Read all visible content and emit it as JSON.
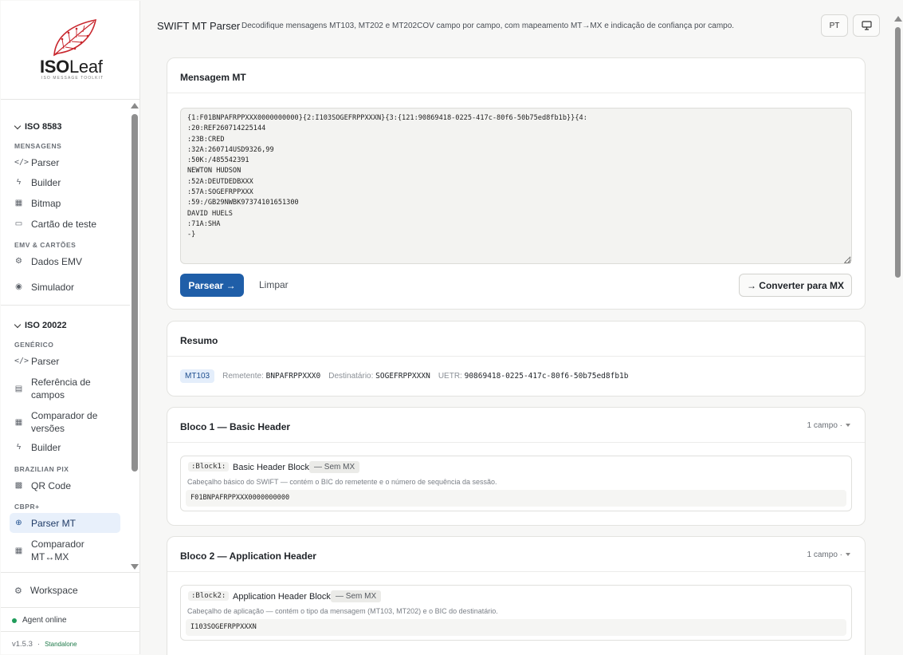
{
  "sidebar": {
    "logo": {
      "brand_bold": "ISO",
      "brand_light": "Leaf",
      "tagline": "ISO MESSAGE TOOLKIT",
      "accent": "#c8262d"
    },
    "groups": [
      {
        "label": "ISO 8583"
      },
      {
        "label": "ISO 20022"
      }
    ],
    "sections": [
      "MENSAGENS",
      "EMV & CARTÕES",
      "GENÉRICO",
      "BRAZILIAN PIX",
      "CBPR+"
    ],
    "items": [
      {
        "label": "Parser",
        "icon": "code-icon"
      },
      {
        "label": "Builder",
        "icon": "bolt-icon"
      },
      {
        "label": "Bitmap",
        "icon": "grid-icon"
      },
      {
        "label": "Cartão de teste",
        "icon": "card-icon"
      },
      {
        "label": "Dados EMV",
        "icon": "chip-icon"
      },
      {
        "label": "Simulador",
        "icon": "broadcast-icon"
      },
      {
        "label": "Parser",
        "icon": "code-icon"
      },
      {
        "label": "Referência de campos",
        "icon": "document-icon"
      },
      {
        "label": "Comparador de versões",
        "icon": "grid-icon"
      },
      {
        "label": "Builder",
        "icon": "bolt-icon"
      },
      {
        "label": "QR Code",
        "icon": "qr-icon"
      },
      {
        "label": "Parser MT",
        "icon": "globe-icon",
        "active": true
      },
      {
        "label": "Comparador MT↔MX",
        "icon": "grid-icon"
      }
    ],
    "workspace": "Workspace",
    "agent_status": "Agent online",
    "version": "v1.5.3",
    "mode": "Standalone",
    "status_color": "#1f9c5a"
  },
  "header": {
    "title": "SWIFT MT Parser",
    "subtitle": "Decodifique mensagens MT103, MT202 e MT202COV campo por campo, com mapeamento MT→MX e indicação de confiança por campo.",
    "lang_button": "PT"
  },
  "message_card": {
    "title": "Mensagem MT",
    "content": "{1:F01BNPAFRPPXXX0000000000}{2:I103SOGEFRPPXXXN}{3:{121:90869418-0225-417c-80f6-50b75ed8fb1b}}{4:\n:20:REF260714225144\n:23B:CRED\n:32A:260714USD9326,99\n:50K:/485542391\nNEWTON HUDSON\n:52A:DEUTDEDBXXX\n:57A:SOGEFRPPXXX\n:59:/GB29NWBK97374101651300\nDAVID HUELS\n:71A:SHA\n-}",
    "parse_button": "Parsear →",
    "clear_button": "Limpar",
    "convert_button": "→ Converter para MX",
    "accent": "#1f5ea8"
  },
  "summary": {
    "title": "Resumo",
    "type": "MT103",
    "sender_label": "Remetente:",
    "sender": "BNPAFRPPXXX0",
    "receiver_label": "Destinatário:",
    "receiver": "SOGEFRPPXXXN",
    "uetr_label": "UETR:",
    "uetr": "90869418-0225-417c-80f6-50b75ed8fb1b"
  },
  "blocks": [
    {
      "title": "Bloco 1 — Basic Header",
      "count": "1 campo ·",
      "tag": ":Block1:",
      "name": "Basic Header Block",
      "mx": "— Sem MX",
      "desc": "Cabeçalho básico do SWIFT — contém o BIC do remetente e o número de sequência da sessão.",
      "value": "F01BNPAFRPPXXX0000000000"
    },
    {
      "title": "Bloco 2 — Application Header",
      "count": "1 campo ·",
      "tag": ":Block2:",
      "name": "Application Header Block",
      "mx": "— Sem MX",
      "desc": "Cabeçalho de aplicação — contém o tipo da mensagem (MT103, MT202) e o BIC do destinatário.",
      "value": "I103SOGEFRPPXXXN"
    }
  ]
}
